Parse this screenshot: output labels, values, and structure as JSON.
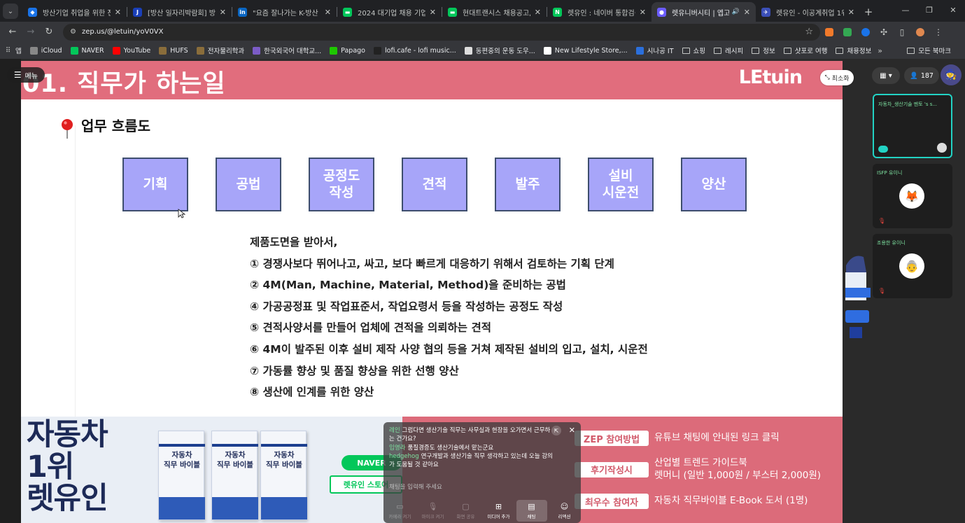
{
  "browser": {
    "tabs": [
      {
        "label": "방산기업 취업을 위한 전",
        "fav_color": "#1a73e8",
        "fav_glyph": "◆",
        "active": false
      },
      {
        "label": "[방산 일자리박람회] 방산",
        "fav_color": "#1a3fb8",
        "fav_glyph": "J",
        "active": false
      },
      {
        "label": "\"요즘 잘나가는 K-방산 주",
        "fav_color": "#0a66c2",
        "fav_glyph": "in",
        "active": false
      },
      {
        "label": "2024 대기업 채용 기업별",
        "fav_color": "#03c75a",
        "fav_glyph": "▬",
        "active": false
      },
      {
        "label": "현대트랜시스 채용공고, 절",
        "fav_color": "#03c75a",
        "fav_glyph": "▬",
        "active": false
      },
      {
        "label": "렛유인 : 네이버 통합검색",
        "fav_color": "#03c75a",
        "fav_glyph": "N",
        "active": false
      },
      {
        "label": "렛유니버시티 | 엡고",
        "fav_color": "#6b5cff",
        "fav_glyph": "●",
        "active": true,
        "audio": "🔊"
      },
      {
        "label": "렛유인 - 이공계취업 1위",
        "fav_color": "#3b4fb8",
        "fav_glyph": "✈",
        "active": false
      }
    ],
    "new_tab": "+",
    "window_controls": [
      "—",
      "❐",
      "✕"
    ],
    "url": "zep.us/@letuin/yoV0VX",
    "bookmarks": [
      {
        "label": "앱",
        "type": "apps"
      },
      {
        "label": "iCloud",
        "color": "#888888"
      },
      {
        "label": "NAVER",
        "color": "#03c75a"
      },
      {
        "label": "YouTube",
        "color": "#ff0000"
      },
      {
        "label": "HUFS",
        "color": "#8a6d3b"
      },
      {
        "label": "전자물리학과",
        "color": "#8a6d3b"
      },
      {
        "label": "한국외국어 대학교...",
        "color": "#7b5cc7"
      },
      {
        "label": "Papago",
        "color": "#1ec800"
      },
      {
        "label": "lofi.cafe - lofi music...",
        "color": "#222222"
      },
      {
        "label": "동편중의 운동 도우...",
        "color": "#dddddd"
      },
      {
        "label": "New Lifestyle Store,...",
        "color": "#ffffff"
      },
      {
        "label": "시나공 IT",
        "color": "#2b6fdc"
      },
      {
        "label": "쇼핑",
        "type": "folder"
      },
      {
        "label": "레시피",
        "type": "folder"
      },
      {
        "label": "정보",
        "type": "folder"
      },
      {
        "label": "샷포로 여행",
        "type": "folder"
      },
      {
        "label": "채용정보",
        "type": "folder"
      }
    ],
    "bookmarks_more": "»",
    "all_bookmarks": "모든 북마크"
  },
  "zep": {
    "menu_label": "메뉴",
    "minimize_label": "최소화",
    "view_toggle": "▦ ▾",
    "participant_count": "187",
    "video_cards": [
      {
        "name": "자동차_생산기술 멘토 's s...",
        "avatar": "🧑",
        "active": true
      },
      {
        "name": "ISFP 유이니",
        "avatar": "🦊",
        "active": false
      },
      {
        "name": "조용한 유이니",
        "avatar": "👵",
        "active": false
      }
    ]
  },
  "slide": {
    "header_title": "01. 직무가 하는일",
    "logo": "LEtuin",
    "section_title": "업무 흐름도",
    "steps": [
      "기획",
      "공법",
      "공정도\n작성",
      "견적",
      "발주",
      "설비\n시운전",
      "양산"
    ],
    "intro": "제품도면을 받아서,",
    "items": [
      "① 경쟁사보다 뛰어나고, 싸고, 보다 빠르게 대응하기 위해서 검토하는 기획 단계",
      "② 4M(Man, Machine, Material, Method)을 준비하는 공법",
      "④ 가공공정표 및 작업표준서, 작업요령서 등을 작성하는 공정도 작성",
      "⑤ 견적사양서를 만들어 업체에 견적을 의뢰하는 견적",
      "⑥ 4M이 발주된 이후 설비 제작 사양 협의 등을 거쳐 제작된 설비의 입고, 설치, 시운전",
      "⑦ 가동률 향상 및 품질 향상을 위한 선행 양산",
      "⑧ 생산에 인계를 위한 양산"
    ]
  },
  "banner": {
    "title_lines": [
      "자동차",
      "1위",
      "렛유인"
    ],
    "book_title": "자동차\n직무 바이블",
    "naver": "NAVER",
    "store": "렛유인 스토어",
    "promos": [
      {
        "pill": "ZEP 참여방법",
        "text": "유튜브 채팅에 안내된 링크 클릭"
      },
      {
        "pill": "후기작성시",
        "text": "산업별 트렌드 가이드북\n렛머니 (일반 1,000원 / 부스터 2,000원)"
      },
      {
        "pill": "최우수 참여자",
        "text": "자동차 직무바이블 E-Book 도서 (1명)"
      }
    ]
  },
  "chat": {
    "messages": [
      {
        "who": "레인",
        "text": "그럼다면 생산기술 직무는 사무실과 현장을 오가면서 근무하는 건가요?"
      },
      {
        "who": "임영라",
        "text": "품질경증도 생산기술에서 맡는군요"
      },
      {
        "who": "hedgehog",
        "text": "연구개발과 생산기술 직무 생각하고 있는데 오늘 강의가 도움될 것 같아요"
      }
    ],
    "input_placeholder": "채팅을 입력해 주세요",
    "buttons": [
      {
        "icon": "▭",
        "label": "카메라 켜기",
        "state": "dim"
      },
      {
        "icon": "🎙",
        "label": "마이크 켜기",
        "state": "dim"
      },
      {
        "icon": "▢",
        "label": "화면 공유",
        "state": "dim"
      },
      {
        "icon": "⊞",
        "label": "미디어 추가",
        "state": "normal"
      },
      {
        "icon": "▤",
        "label": "채팅",
        "state": "on"
      },
      {
        "icon": "☺",
        "label": "리액션",
        "state": "normal"
      }
    ]
  }
}
